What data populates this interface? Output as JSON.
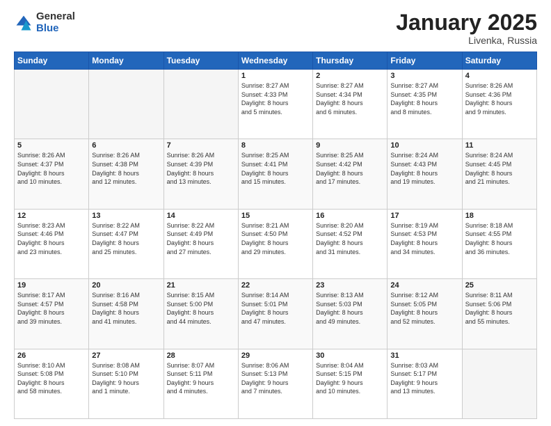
{
  "header": {
    "logo_general": "General",
    "logo_blue": "Blue",
    "month_title": "January 2025",
    "location": "Livenka, Russia"
  },
  "weekdays": [
    "Sunday",
    "Monday",
    "Tuesday",
    "Wednesday",
    "Thursday",
    "Friday",
    "Saturday"
  ],
  "weeks": [
    [
      {
        "day": "",
        "info": ""
      },
      {
        "day": "",
        "info": ""
      },
      {
        "day": "",
        "info": ""
      },
      {
        "day": "1",
        "info": "Sunrise: 8:27 AM\nSunset: 4:33 PM\nDaylight: 8 hours\nand 5 minutes."
      },
      {
        "day": "2",
        "info": "Sunrise: 8:27 AM\nSunset: 4:34 PM\nDaylight: 8 hours\nand 6 minutes."
      },
      {
        "day": "3",
        "info": "Sunrise: 8:27 AM\nSunset: 4:35 PM\nDaylight: 8 hours\nand 8 minutes."
      },
      {
        "day": "4",
        "info": "Sunrise: 8:26 AM\nSunset: 4:36 PM\nDaylight: 8 hours\nand 9 minutes."
      }
    ],
    [
      {
        "day": "5",
        "info": "Sunrise: 8:26 AM\nSunset: 4:37 PM\nDaylight: 8 hours\nand 10 minutes."
      },
      {
        "day": "6",
        "info": "Sunrise: 8:26 AM\nSunset: 4:38 PM\nDaylight: 8 hours\nand 12 minutes."
      },
      {
        "day": "7",
        "info": "Sunrise: 8:26 AM\nSunset: 4:39 PM\nDaylight: 8 hours\nand 13 minutes."
      },
      {
        "day": "8",
        "info": "Sunrise: 8:25 AM\nSunset: 4:41 PM\nDaylight: 8 hours\nand 15 minutes."
      },
      {
        "day": "9",
        "info": "Sunrise: 8:25 AM\nSunset: 4:42 PM\nDaylight: 8 hours\nand 17 minutes."
      },
      {
        "day": "10",
        "info": "Sunrise: 8:24 AM\nSunset: 4:43 PM\nDaylight: 8 hours\nand 19 minutes."
      },
      {
        "day": "11",
        "info": "Sunrise: 8:24 AM\nSunset: 4:45 PM\nDaylight: 8 hours\nand 21 minutes."
      }
    ],
    [
      {
        "day": "12",
        "info": "Sunrise: 8:23 AM\nSunset: 4:46 PM\nDaylight: 8 hours\nand 23 minutes."
      },
      {
        "day": "13",
        "info": "Sunrise: 8:22 AM\nSunset: 4:47 PM\nDaylight: 8 hours\nand 25 minutes."
      },
      {
        "day": "14",
        "info": "Sunrise: 8:22 AM\nSunset: 4:49 PM\nDaylight: 8 hours\nand 27 minutes."
      },
      {
        "day": "15",
        "info": "Sunrise: 8:21 AM\nSunset: 4:50 PM\nDaylight: 8 hours\nand 29 minutes."
      },
      {
        "day": "16",
        "info": "Sunrise: 8:20 AM\nSunset: 4:52 PM\nDaylight: 8 hours\nand 31 minutes."
      },
      {
        "day": "17",
        "info": "Sunrise: 8:19 AM\nSunset: 4:53 PM\nDaylight: 8 hours\nand 34 minutes."
      },
      {
        "day": "18",
        "info": "Sunrise: 8:18 AM\nSunset: 4:55 PM\nDaylight: 8 hours\nand 36 minutes."
      }
    ],
    [
      {
        "day": "19",
        "info": "Sunrise: 8:17 AM\nSunset: 4:57 PM\nDaylight: 8 hours\nand 39 minutes."
      },
      {
        "day": "20",
        "info": "Sunrise: 8:16 AM\nSunset: 4:58 PM\nDaylight: 8 hours\nand 41 minutes."
      },
      {
        "day": "21",
        "info": "Sunrise: 8:15 AM\nSunset: 5:00 PM\nDaylight: 8 hours\nand 44 minutes."
      },
      {
        "day": "22",
        "info": "Sunrise: 8:14 AM\nSunset: 5:01 PM\nDaylight: 8 hours\nand 47 minutes."
      },
      {
        "day": "23",
        "info": "Sunrise: 8:13 AM\nSunset: 5:03 PM\nDaylight: 8 hours\nand 49 minutes."
      },
      {
        "day": "24",
        "info": "Sunrise: 8:12 AM\nSunset: 5:05 PM\nDaylight: 8 hours\nand 52 minutes."
      },
      {
        "day": "25",
        "info": "Sunrise: 8:11 AM\nSunset: 5:06 PM\nDaylight: 8 hours\nand 55 minutes."
      }
    ],
    [
      {
        "day": "26",
        "info": "Sunrise: 8:10 AM\nSunset: 5:08 PM\nDaylight: 8 hours\nand 58 minutes."
      },
      {
        "day": "27",
        "info": "Sunrise: 8:08 AM\nSunset: 5:10 PM\nDaylight: 9 hours\nand 1 minute."
      },
      {
        "day": "28",
        "info": "Sunrise: 8:07 AM\nSunset: 5:11 PM\nDaylight: 9 hours\nand 4 minutes."
      },
      {
        "day": "29",
        "info": "Sunrise: 8:06 AM\nSunset: 5:13 PM\nDaylight: 9 hours\nand 7 minutes."
      },
      {
        "day": "30",
        "info": "Sunrise: 8:04 AM\nSunset: 5:15 PM\nDaylight: 9 hours\nand 10 minutes."
      },
      {
        "day": "31",
        "info": "Sunrise: 8:03 AM\nSunset: 5:17 PM\nDaylight: 9 hours\nand 13 minutes."
      },
      {
        "day": "",
        "info": ""
      }
    ]
  ]
}
